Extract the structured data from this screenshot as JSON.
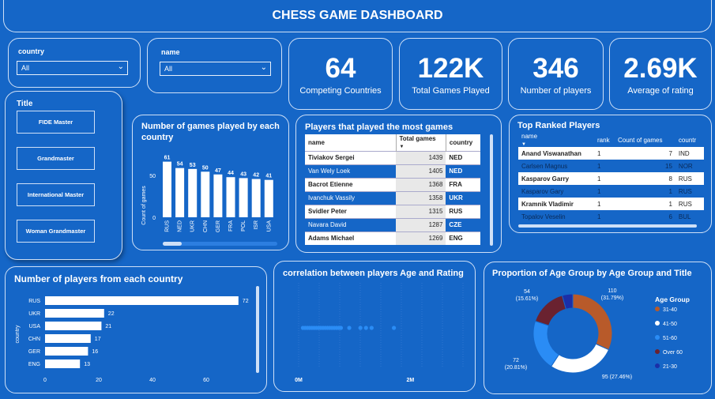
{
  "header": {
    "title": "CHESS GAME DASHBOARD"
  },
  "slicers": {
    "country": {
      "label": "country",
      "value": "All"
    },
    "name": {
      "label": "name",
      "value": "All"
    }
  },
  "kpis": [
    {
      "value": "64",
      "label": "Competing Countries"
    },
    {
      "value": "122K",
      "label": "Total Games Played"
    },
    {
      "value": "346",
      "label": "Number of players"
    },
    {
      "value": "2.69K",
      "label": "Average of rating"
    }
  ],
  "title_slicer": {
    "label": "Title",
    "options": [
      "FIDE Master",
      "Grandmaster",
      "International Master",
      "Woman Grandmaster"
    ]
  },
  "games_by_country": {
    "title": "Number of games played by each country",
    "ylabel": "Count of games",
    "ytick_50": "50",
    "ytick_0": "0"
  },
  "most_games": {
    "title": "Players that played the most games",
    "columns": [
      "name",
      "Total games",
      "country"
    ],
    "rows": [
      [
        "Tiviakov Sergei",
        "1439",
        "NED"
      ],
      [
        "Van Wely Loek",
        "1405",
        "NED"
      ],
      [
        "Bacrot Etienne",
        "1368",
        "FRA"
      ],
      [
        "Ivanchuk Vassily",
        "1358",
        "UKR"
      ],
      [
        "Svidler Peter",
        "1315",
        "RUS"
      ],
      [
        "Navara David",
        "1287",
        "CZE"
      ],
      [
        "Adams Michael",
        "1269",
        "ENG"
      ]
    ]
  },
  "top_ranked": {
    "title": "Top Ranked Players",
    "columns": [
      "name",
      "rank",
      "Count of games",
      "countr"
    ],
    "rows": [
      [
        "Anand Viswanathan",
        "1",
        "7",
        "IND"
      ],
      [
        "Carlsen Magnus",
        "1",
        "15",
        "NOR"
      ],
      [
        "Kasparov Garry",
        "1",
        "8",
        "RUS"
      ],
      [
        "Kasparov Gary",
        "1",
        "1",
        "RUS"
      ],
      [
        "Kramnik Vladimir",
        "1",
        "1",
        "RUS"
      ],
      [
        "Topalov Veselin",
        "1",
        "6",
        "BUL"
      ]
    ]
  },
  "players_by_country": {
    "title": "Number of players from each country",
    "ylabel": "country",
    "xticks": [
      "0",
      "20",
      "40",
      "60"
    ]
  },
  "correlation": {
    "title": "correlation between players Age and Rating",
    "xticks": [
      "0M",
      "2M"
    ]
  },
  "age_group": {
    "title": "Proportion of Age Group by Age Group and Title",
    "legend_title": "Age Group"
  },
  "chart_data": [
    {
      "type": "bar",
      "title": "Number of games played by each country",
      "ylabel": "Count of games",
      "categories": [
        "RUS",
        "NED",
        "UKR",
        "CHN",
        "GER",
        "FRA",
        "POL",
        "ISR",
        "USA"
      ],
      "values": [
        61,
        54,
        53,
        50,
        47,
        44,
        43,
        42,
        41
      ],
      "ylim": [
        0,
        65
      ],
      "color": "#ffffff"
    },
    {
      "type": "bar",
      "orientation": "horizontal",
      "title": "Number of players from each country",
      "ylabel": "country",
      "categories": [
        "RUS",
        "UKR",
        "USA",
        "CHN",
        "GER",
        "ENG"
      ],
      "values": [
        72,
        22,
        21,
        17,
        16,
        13
      ],
      "xlim": [
        0,
        80
      ],
      "color": "#ffffff"
    },
    {
      "type": "scatter",
      "title": "correlation between players Age and Rating",
      "xlim": [
        0,
        3
      ],
      "x": [
        0.02,
        0.06,
        0.1,
        0.14,
        0.18,
        0.22,
        0.26,
        0.3,
        0.34,
        0.38,
        0.42,
        0.46,
        0.5,
        0.54,
        0.58,
        0.62,
        0.66,
        0.7,
        0.85,
        1.05,
        1.15,
        1.25,
        1.65
      ],
      "color": "#2a8cf5"
    },
    {
      "type": "pie",
      "title": "Proportion of Age Group by Age Group and Title",
      "legend_title": "Age Group",
      "slices": [
        {
          "label": "31-40",
          "value": 110,
          "pct": "(31.79%)",
          "color": "#b85a2a"
        },
        {
          "label": "41-50",
          "value": 95,
          "pct": "(27.46%)",
          "color": "#ffffff"
        },
        {
          "label": "51-60",
          "value": 72,
          "pct": "(20.81%)",
          "color": "#2a8cf5"
        },
        {
          "label": "Over 60",
          "value": 54,
          "pct": "(15.61%)",
          "color": "#6a2230"
        },
        {
          "label": "21-30",
          "value": 15,
          "pct": "",
          "color": "#1a2fa8"
        }
      ]
    }
  ]
}
